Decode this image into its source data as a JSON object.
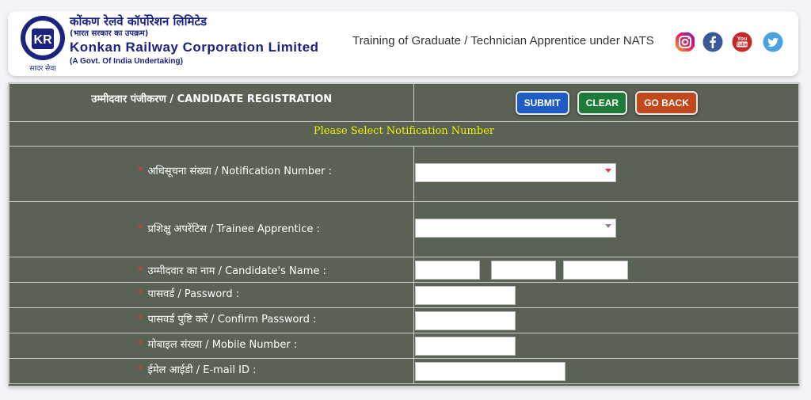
{
  "header": {
    "org_hindi": "कोंकण रेलवे कॉर्पोरेशन लिमिटेड",
    "org_hindi_sub": "(भारत सरकार का उपक्रम)",
    "org_english": "Konkan Railway Corporation Limited",
    "org_govt": "(A Govt. Of India Undertaking)",
    "logo_motto": "सादर सेवा",
    "logo_top_text": "कोंकण रेल",
    "logo_letters": "KR",
    "tagline": "Training of Graduate / Technician Apprentice under NATS",
    "social": [
      "instagram-icon",
      "facebook-icon",
      "youtube-icon",
      "twitter-icon"
    ]
  },
  "form": {
    "title": "उम्मीदवार पंजीकरण / CANDIDATE REGISTRATION",
    "buttons": {
      "submit": "SUBMIT",
      "clear": "CLEAR",
      "back": "GO BACK"
    },
    "notice": "Please Select Notification Number",
    "required_mark": "*",
    "fields": {
      "notification": "अधिसूचना संख्या / Notification Number :",
      "trainee": "प्रशिक्षु अपरेंटिस / Trainee Apprentice :",
      "name": "उम्मीदवार का नाम / Candidate's Name :",
      "password": "पासवर्ड / Password :",
      "confirm": "पासवर्ड पुष्टि करें / Confirm Password :",
      "mobile": "मोबाइल संख्या / Mobile Number :",
      "email": "ईमेल आईडी / E-mail ID :"
    }
  },
  "colors": {
    "panel": "#596255",
    "notice": "#f5f500",
    "required": "#e53935",
    "caret_notification": "#e53935",
    "caret_trainee": "#888888",
    "brand": "#1a237e"
  }
}
